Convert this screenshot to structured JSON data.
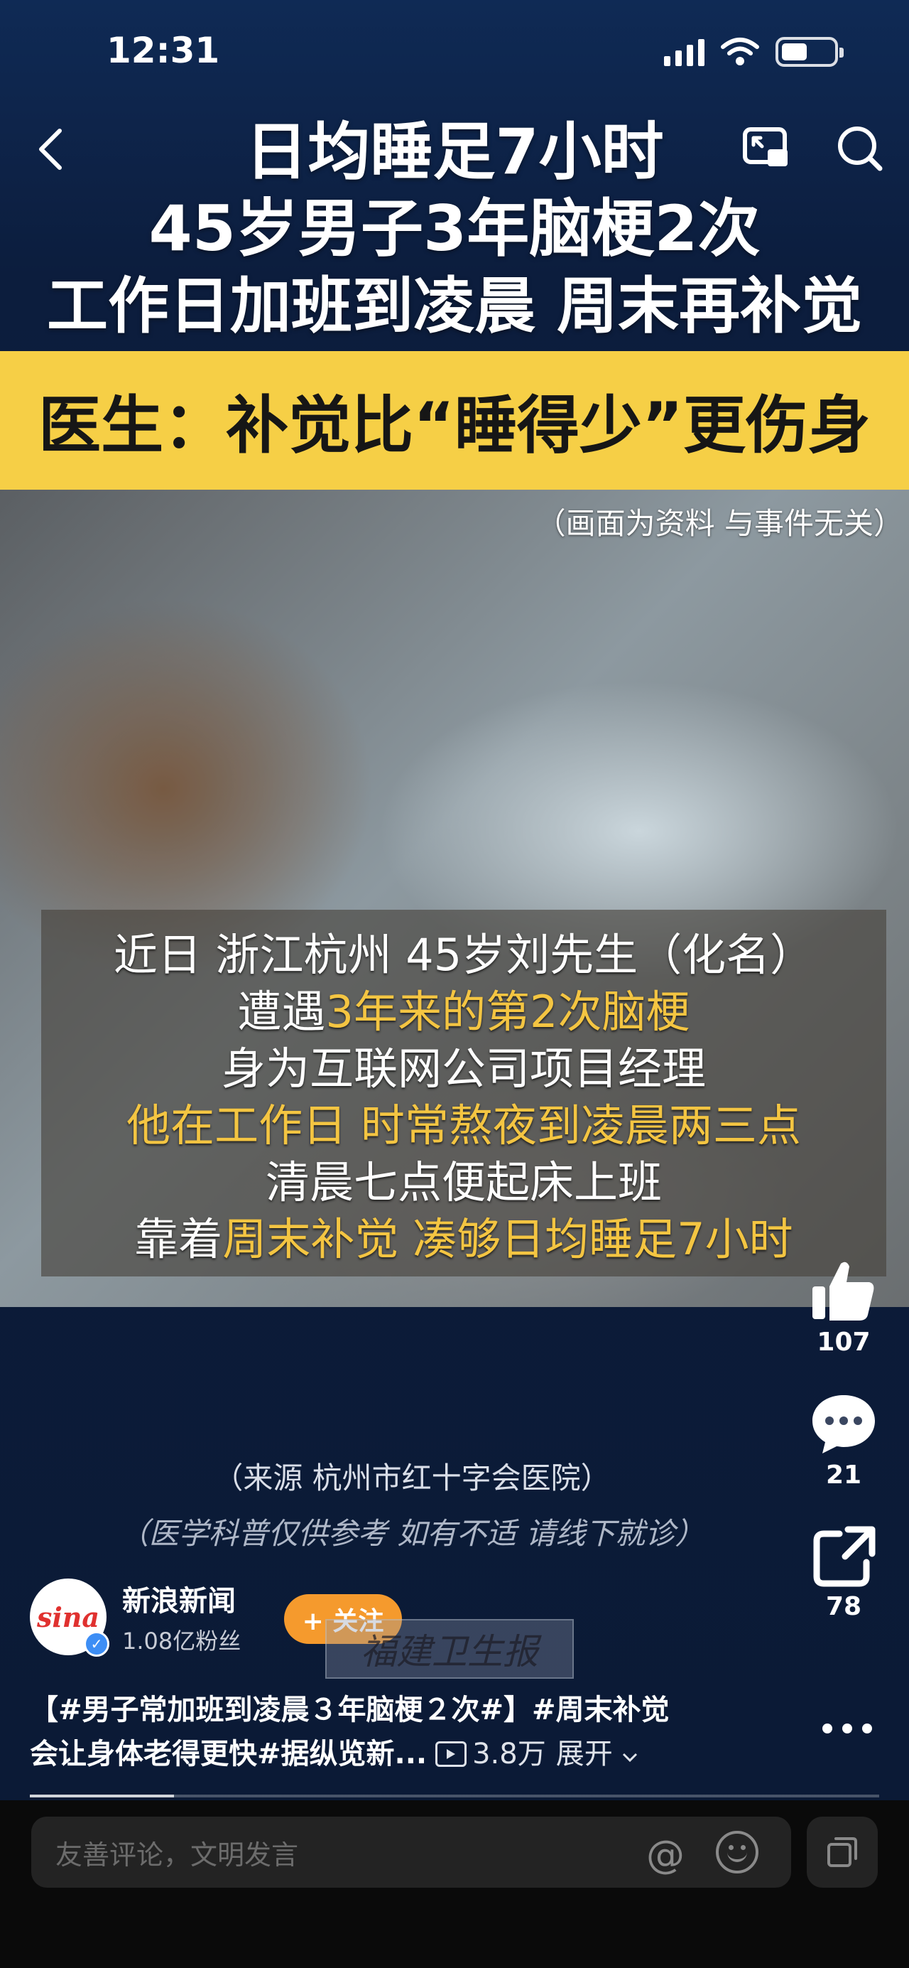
{
  "status_bar": {
    "time": "12:31"
  },
  "video": {
    "headline": [
      "日均睡足7小时",
      "45岁男子3年脑梗2次",
      "工作日加班到凌晨 周末再补觉"
    ],
    "banner": "医生：补觉比“睡得少”更伤身",
    "frame_note": "（画面为资料 与事件无关）",
    "caption": {
      "line1": "近日 浙江杭州 45岁刘先生（化名）",
      "line2_white": "遭遇",
      "line2_yellow": "3年来的第2次脑梗",
      "line3": "身为互联网公司项目经理",
      "line4": "他在工作日 时常熬夜到凌晨两三点",
      "line5": "清晨七点便起床上班",
      "line6_white": "靠着",
      "line6_yellow": "周末补觉 凑够日均睡足7小时"
    },
    "source": "（来源 杭州市红十字会医院）",
    "disclaimer": "（医学科普仅供参考  如有不适  请线下就诊）",
    "watermark": "福建卫生报",
    "progress_fraction": 0.17
  },
  "actions": {
    "like_count": "107",
    "comment_count": "21",
    "share_count": "78"
  },
  "author": {
    "avatar_text": "sina",
    "name": "新浪新闻",
    "fans": "1.08亿粉丝",
    "follow_label": "+ 关注"
  },
  "description": {
    "line1": "【#男子常加班到凌晨３年脑梗２次#】#周末补觉",
    "line2": "会让身体老得更快#据纵览新...",
    "views": "3.8万",
    "expand_label": "展开"
  },
  "comment_bar": {
    "placeholder": "友善评论，文明发言"
  },
  "colors": {
    "banner": "#f6cf46",
    "caption_highlight": "#f4c542",
    "follow_button": "#f59a2d",
    "verified_badge": "#3d8ef5"
  }
}
